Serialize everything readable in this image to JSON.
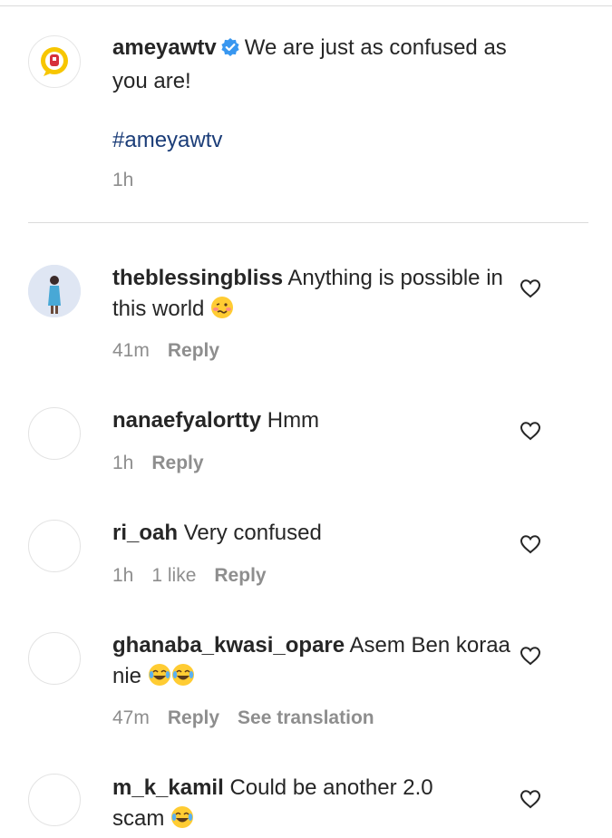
{
  "caption": {
    "username": "ameyawtv",
    "text_line1": "We are just as confused as",
    "text_line2": "you are!",
    "hashtag": "#ameyawtv",
    "time": "1h"
  },
  "comments": [
    {
      "username": "theblessingbliss",
      "text": "Anything is possible in this world",
      "emoji": "woozy-face-emoji",
      "time": "41m",
      "likes": "",
      "reply_label": "Reply",
      "translate_label": ""
    },
    {
      "username": "nanaefyalortty",
      "text": "Hmm",
      "time": "1h",
      "likes": "",
      "reply_label": "Reply",
      "translate_label": ""
    },
    {
      "username": "ri_oah",
      "text": "Very confused",
      "time": "1h",
      "likes": "1 like",
      "reply_label": "Reply",
      "translate_label": ""
    },
    {
      "username": "ghanaba_kwasi_opare",
      "text": "Asem Ben koraa nie",
      "emoji": "tears-of-joy-emoji",
      "time": "47m",
      "likes": "",
      "reply_label": "Reply",
      "translate_label": "See translation"
    },
    {
      "username": "m_k_kamil",
      "text": "Could be another 2.0 scam",
      "emoji": "tears-of-joy-emoji",
      "time": "",
      "likes": "",
      "reply_label": "",
      "translate_label": ""
    }
  ],
  "icons": {
    "verified": "verified-badge-icon",
    "like": "heart-outline-icon"
  },
  "colors": {
    "text": "#262626",
    "muted": "#8e8e8e",
    "hashtag": "#1b3d78",
    "verified": "#3897f0",
    "divider": "#dbdbdb",
    "logo_yellow": "#f7c600",
    "logo_red": "#d6303a"
  }
}
